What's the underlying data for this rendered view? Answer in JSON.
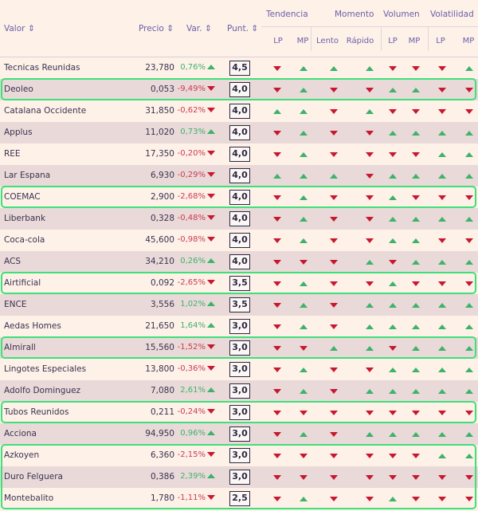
{
  "header": {
    "valor": "Valor",
    "precio": "Precio",
    "var": "Var.",
    "punt": "Punt.",
    "sort_icon": "sort-updown-icon",
    "groups": [
      "Tendencia",
      "Momento",
      "Volumen",
      "Volatilidad"
    ],
    "sub": [
      "LP",
      "MP",
      "Lento",
      "Rápido",
      "LP",
      "MP",
      "LP",
      "MP"
    ]
  },
  "colors": {
    "up": "#3db36a",
    "down": "#c8172f",
    "highlight": "#3ee07a"
  },
  "rows": [
    {
      "name": "Tecnicas Reunidas",
      "price": "23,780",
      "var": "0,76%",
      "dir": "up",
      "score": "4,5",
      "ind": [
        "down",
        "up",
        "up",
        "up",
        "down",
        "down",
        "down",
        "up"
      ]
    },
    {
      "name": "Deoleo",
      "price": "0,053",
      "var": "-9,49%",
      "dir": "down",
      "score": "4,0",
      "ind": [
        "down",
        "up",
        "down",
        "down",
        "up",
        "up",
        "down",
        "down"
      ]
    },
    {
      "name": "Catalana Occidente",
      "price": "31,850",
      "var": "-0,62%",
      "dir": "down",
      "score": "4,0",
      "ind": [
        "up",
        "up",
        "down",
        "up",
        "down",
        "down",
        "down",
        "down"
      ]
    },
    {
      "name": "Applus",
      "price": "11,020",
      "var": "0,73%",
      "dir": "up",
      "score": "4,0",
      "ind": [
        "down",
        "up",
        "down",
        "down",
        "up",
        "up",
        "up",
        "up"
      ]
    },
    {
      "name": "REE",
      "price": "17,350",
      "var": "-0,20%",
      "dir": "down",
      "score": "4,0",
      "ind": [
        "down",
        "up",
        "down",
        "down",
        "down",
        "down",
        "up",
        "up"
      ]
    },
    {
      "name": "Lar Espana",
      "price": "6,930",
      "var": "-0,29%",
      "dir": "down",
      "score": "4,0",
      "ind": [
        "up",
        "up",
        "up",
        "down",
        "up",
        "up",
        "up",
        "up"
      ]
    },
    {
      "name": "COEMAC",
      "price": "2,900",
      "var": "-2,68%",
      "dir": "down",
      "score": "4,0",
      "ind": [
        "down",
        "up",
        "down",
        "down",
        "up",
        "down",
        "down",
        "down"
      ]
    },
    {
      "name": "Liberbank",
      "price": "0,328",
      "var": "-0,48%",
      "dir": "down",
      "score": "4,0",
      "ind": [
        "down",
        "up",
        "down",
        "down",
        "up",
        "up",
        "up",
        "up"
      ]
    },
    {
      "name": "Coca-cola",
      "price": "45,600",
      "var": "-0,98%",
      "dir": "down",
      "score": "4,0",
      "ind": [
        "down",
        "up",
        "down",
        "down",
        "up",
        "up",
        "down",
        "down"
      ]
    },
    {
      "name": "ACS",
      "price": "34,210",
      "var": "0,26%",
      "dir": "up",
      "score": "4,0",
      "ind": [
        "down",
        "down",
        "down",
        "up",
        "down",
        "up",
        "up",
        "up"
      ]
    },
    {
      "name": "Airtificial",
      "price": "0,092",
      "var": "-2,65%",
      "dir": "down",
      "score": "3,5",
      "ind": [
        "down",
        "up",
        "down",
        "down",
        "up",
        "down",
        "down",
        "down"
      ]
    },
    {
      "name": "ENCE",
      "price": "3,556",
      "var": "1,02%",
      "dir": "up",
      "score": "3,5",
      "ind": [
        "down",
        "up",
        "down",
        "up",
        "up",
        "up",
        "up",
        "up"
      ]
    },
    {
      "name": "Aedas Homes",
      "price": "21,650",
      "var": "1,64%",
      "dir": "up",
      "score": "3,0",
      "ind": [
        "down",
        "up",
        "down",
        "up",
        "up",
        "up",
        "up",
        "up"
      ]
    },
    {
      "name": "Almirall",
      "price": "15,560",
      "var": "-1,52%",
      "dir": "down",
      "score": "3,0",
      "ind": [
        "down",
        "down",
        "up",
        "up",
        "down",
        "up",
        "up",
        "up"
      ]
    },
    {
      "name": "Lingotes Especiales",
      "price": "13,800",
      "var": "-0,36%",
      "dir": "down",
      "score": "3,0",
      "ind": [
        "down",
        "up",
        "down",
        "down",
        "up",
        "up",
        "up",
        "up"
      ]
    },
    {
      "name": "Adolfo Dominguez",
      "price": "7,080",
      "var": "2,61%",
      "dir": "up",
      "score": "3,0",
      "ind": [
        "down",
        "up",
        "down",
        "up",
        "up",
        "up",
        "up",
        "up"
      ]
    },
    {
      "name": "Tubos Reunidos",
      "price": "0,211",
      "var": "-0,24%",
      "dir": "down",
      "score": "3,0",
      "ind": [
        "down",
        "down",
        "down",
        "down",
        "down",
        "down",
        "down",
        "down"
      ]
    },
    {
      "name": "Acciona",
      "price": "94,950",
      "var": "0,96%",
      "dir": "up",
      "score": "3,0",
      "ind": [
        "down",
        "up",
        "down",
        "up",
        "up",
        "up",
        "up",
        "up"
      ]
    },
    {
      "name": "Azkoyen",
      "price": "6,360",
      "var": "-2,15%",
      "dir": "down",
      "score": "3,0",
      "ind": [
        "down",
        "down",
        "down",
        "down",
        "down",
        "down",
        "up",
        "up"
      ]
    },
    {
      "name": "Duro Felguera",
      "price": "0,386",
      "var": "2,39%",
      "dir": "up",
      "score": "3,0",
      "ind": [
        "down",
        "down",
        "down",
        "down",
        "down",
        "down",
        "down",
        "down"
      ]
    },
    {
      "name": "Montebalito",
      "price": "1,780",
      "var": "-1,11%",
      "dir": "down",
      "score": "2,5",
      "ind": [
        "down",
        "up",
        "down",
        "down",
        "up",
        "down",
        "down",
        "down"
      ]
    }
  ]
}
